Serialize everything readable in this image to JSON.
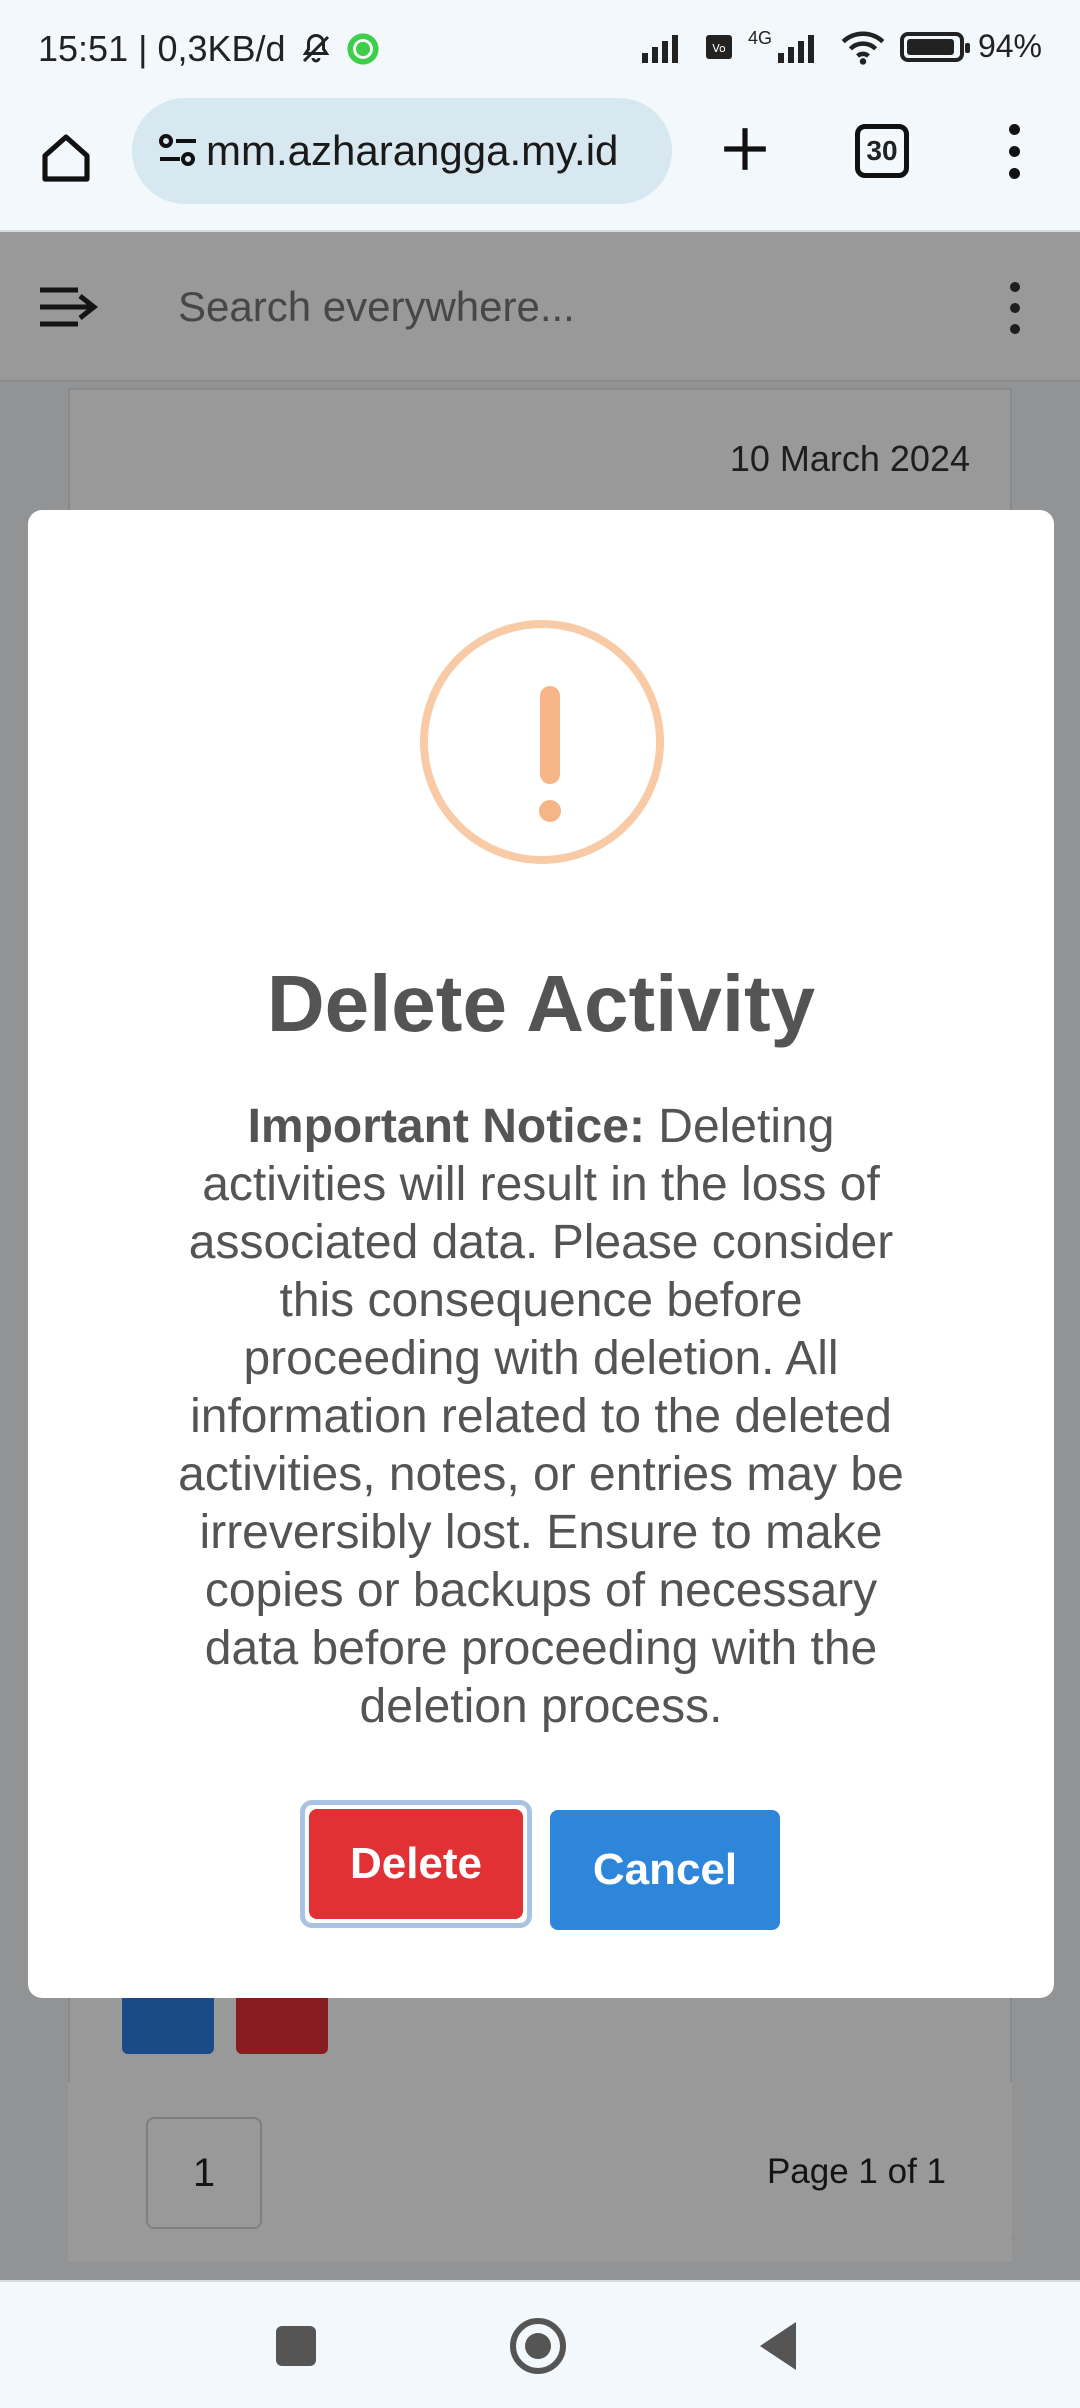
{
  "status_bar": {
    "time_info": "15:51 | 0,3KB/d",
    "network": "4G",
    "battery": "94%"
  },
  "browser": {
    "url": "mm.azharangga.my.id",
    "tab_count": "30"
  },
  "app": {
    "search_placeholder": "Search everywhere...",
    "card_date": "10 March 2024",
    "pagination": {
      "current_page": "1",
      "info": "Page 1 of 1"
    }
  },
  "modal": {
    "title": "Delete Activity",
    "notice_label": "Important Notice:",
    "notice_text": " Deleting activities will result in the loss of associated data. Please consider this consequence before proceeding with deletion. All information related to the deleted activities, notes, or entries may be irreversibly lost. Ensure to make copies or backups of necessary data before proceeding with the deletion process.",
    "delete_label": "Delete",
    "cancel_label": "Cancel",
    "icon": "warning-icon",
    "colors": {
      "warning": "#f8bb86",
      "delete": "#e23134",
      "cancel": "#2e86db"
    }
  }
}
